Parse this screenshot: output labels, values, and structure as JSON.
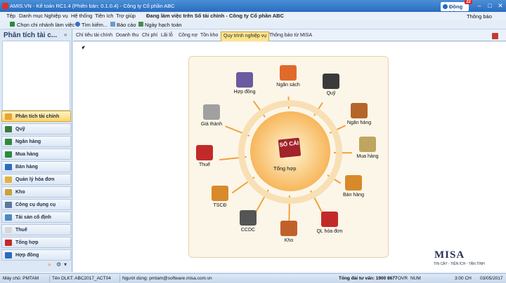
{
  "window": {
    "title": "AMIS.VN - Kế toán RC1.4 (Phiên bản: 0.1.0.4) - Công ty Cổ phần ABC",
    "sync_label": "Đồng bộ",
    "sync_badge": "22",
    "notifications_label": "Thông báo"
  },
  "menu": {
    "items": [
      "Tệp",
      "Danh mục",
      "Nghiệp vụ",
      "Hệ thống",
      "Tiện ích",
      "Trợ giúp"
    ],
    "working_on": "Đang làm việc trên Sổ tài chính - Công ty Cổ phần ABC"
  },
  "toolbar": {
    "choose_branch": "Chọn chi nhánh làm việc",
    "search": "Tìm kiếm...",
    "report": "Báo cáo",
    "accounting_date": "Ngày hạch toán"
  },
  "left_panel": {
    "title": "Phân tích tài c...",
    "collapse": "«",
    "items": [
      {
        "label": "Phân tích tài chính",
        "color": "#e8a23a",
        "active": true
      },
      {
        "label": "Quỹ",
        "color": "#3a7a3a"
      },
      {
        "label": "Ngân hàng",
        "color": "#2d8a3e"
      },
      {
        "label": "Mua hàng",
        "color": "#2d8a3e"
      },
      {
        "label": "Bán hàng",
        "color": "#2a6cc0"
      },
      {
        "label": "Quản lý hóa đơn",
        "color": "#e2b23a"
      },
      {
        "label": "Kho",
        "color": "#c8a23a"
      },
      {
        "label": "Công cụ dụng cụ",
        "color": "#5a7aa0"
      },
      {
        "label": "Tài sản cố định",
        "color": "#4a8ac0"
      },
      {
        "label": "Thuế",
        "color": "#d8d8d8"
      },
      {
        "label": "Tổng hợp",
        "color": "#c22a2a"
      },
      {
        "label": "Hợp đồng",
        "color": "#2a6cc0"
      }
    ],
    "bottom_icons": [
      "»",
      "⚙",
      "▾"
    ]
  },
  "tabs": [
    {
      "label": "Chỉ tiêu tài chính"
    },
    {
      "label": "Doanh thu"
    },
    {
      "label": "Chi phí"
    },
    {
      "label": "Lãi lỗ"
    },
    {
      "label": "Công nợ"
    },
    {
      "label": "Tồn kho"
    },
    {
      "label": "Quy trình nghiệp vụ",
      "active": true
    },
    {
      "label": "Thông báo từ MISA"
    }
  ],
  "diagram": {
    "center": {
      "label": "Tổng hợp",
      "book_text": "SỔ CÁI"
    },
    "nodes": [
      {
        "label": "Ngân sách",
        "icon": "budget-chart-icon",
        "color": "#e06a2c"
      },
      {
        "label": "Quỹ",
        "icon": "safe-icon",
        "color": "#3a3a3a"
      },
      {
        "label": "Ngân hàng",
        "icon": "bank-icon",
        "color": "#b5652a"
      },
      {
        "label": "Mua hàng",
        "icon": "shopping-cart-icon",
        "color": "#c0a560"
      },
      {
        "label": "Bán hàng",
        "icon": "sale-icon",
        "color": "#d88a2a"
      },
      {
        "label": "QL hóa đơn",
        "icon": "invoice-icon",
        "color": "#c22a2a"
      },
      {
        "label": "Kho",
        "icon": "warehouse-icon",
        "color": "#c2602a"
      },
      {
        "label": "CCDC",
        "icon": "tools-icon",
        "color": "#555555"
      },
      {
        "label": "TSCĐ",
        "icon": "house-icon",
        "color": "#d98a2a"
      },
      {
        "label": "Thuế",
        "icon": "tax-icon",
        "color": "#c22a2a"
      },
      {
        "label": "Giá thành",
        "icon": "price-tag-icon",
        "color": "#a0a0a0"
      },
      {
        "label": "Hợp đồng",
        "icon": "contract-icon",
        "color": "#6a5aa0"
      }
    ]
  },
  "brand": {
    "name": "MISA",
    "tagline": "TIN CẬY - TIỆN ÍCH - TẬN TÌNH"
  },
  "status": {
    "user": "Máy chủ: PMTAM",
    "db": "Tên DLKT: ABC2017_ACT04",
    "login": "Người dùng: pmtam@software.misa.com.vn",
    "hotline": "Tổng đài tư vấn: 1900 8677",
    "ovr": "OVR",
    "num": "NUM",
    "time": "3:00 CH",
    "date": "03/05/2017"
  }
}
